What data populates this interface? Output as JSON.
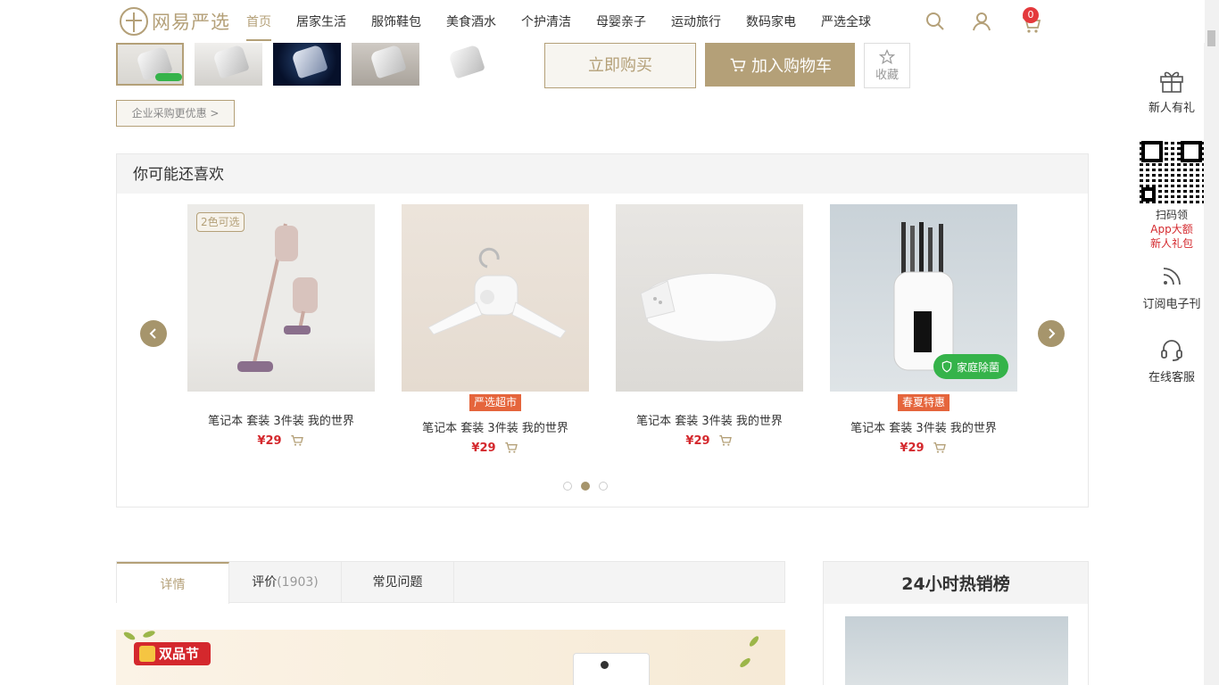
{
  "header": {
    "logo_text": "网易严选",
    "nav": [
      "首页",
      "居家生活",
      "服饰鞋包",
      "美食酒水",
      "个护清洁",
      "母婴亲子",
      "运动旅行",
      "数码家电",
      "严选全球"
    ],
    "cart_count": "0",
    "icons": [
      "search-icon",
      "user-icon",
      "cart-icon"
    ]
  },
  "product": {
    "thumbnail_count": 5,
    "selected_thumbnail": 1,
    "buy_now": "立即购买",
    "add_to_cart": "加入购物车",
    "favorite": "收藏",
    "enterprise": "企业采购更优惠 >"
  },
  "recommend": {
    "title": "你可能还喜欢",
    "items": [
      {
        "name": "笔记本 套装 3件装 我的世界",
        "price": "¥29",
        "badge": "2色可选",
        "tag": ""
      },
      {
        "name": "笔记本 套装 3件装 我的世界",
        "price": "¥29",
        "badge": "",
        "tag": "严选超市"
      },
      {
        "name": "笔记本 套装 3件装 我的世界",
        "price": "¥29",
        "badge": "",
        "tag": ""
      },
      {
        "name": "笔记本 套装 3件装 我的世界",
        "price": "¥29",
        "badge": "家庭除菌",
        "tag": "春夏特惠"
      }
    ],
    "page_count": 3,
    "active_page": 2
  },
  "tabs": {
    "detail": "详情",
    "review": "评价",
    "review_count": "(1903)",
    "faq": "常见问题"
  },
  "banner": {
    "festival": "双品节"
  },
  "hot": {
    "title": "24小时热销榜"
  },
  "sidebar": {
    "gift": "新人有礼",
    "scan": "扫码领",
    "app_line1": "App大额",
    "app_line2": "新人礼包",
    "subscribe": "订阅电子刊",
    "service": "在线客服"
  },
  "colors": {
    "accent": "#b4a078",
    "price": "#d4282d",
    "tag": "#e5653c",
    "green": "#35b34a"
  }
}
